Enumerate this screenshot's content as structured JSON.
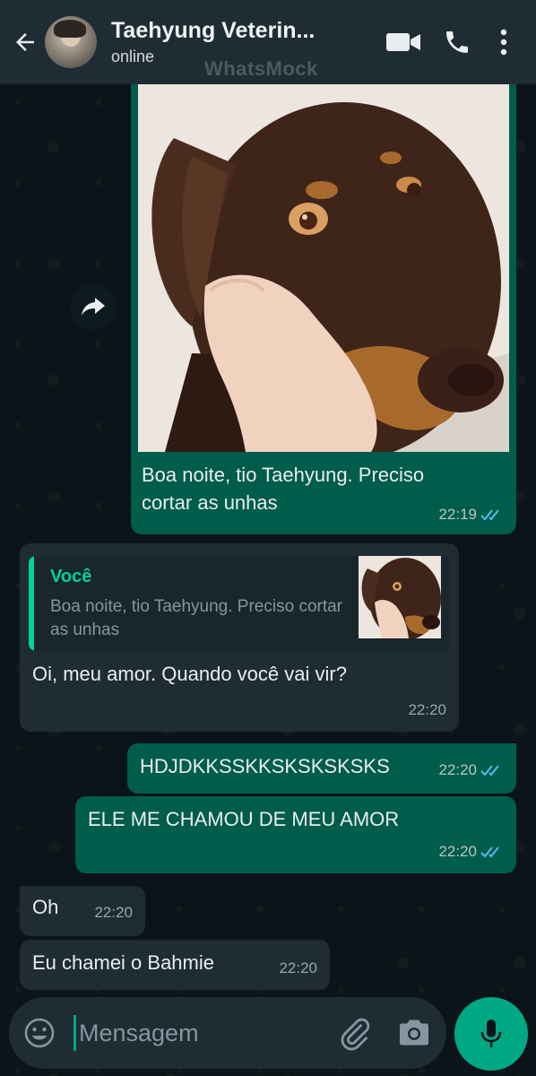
{
  "header": {
    "contact_name": "Taehyung Veterin...",
    "status": "online",
    "watermark": "WhatsMock"
  },
  "icons": {
    "back": "arrow-left-icon",
    "video": "video-camera-icon",
    "call": "phone-icon",
    "menu": "more-vertical-icon",
    "forward": "forward-icon",
    "emoji": "emoji-icon",
    "attach": "paperclip-icon",
    "camera": "camera-icon",
    "mic": "microphone-icon"
  },
  "colors": {
    "outgoing_bubble": "#005c4b",
    "incoming_bubble": "#1f2c33",
    "accent": "#00a884",
    "read_ticks": "#53bdeb"
  },
  "messages": [
    {
      "direction": "out",
      "type": "image",
      "caption": "Boa noite, tio Taehyung. Preciso cortar as unhas",
      "time": "22:19",
      "read": true
    },
    {
      "direction": "in",
      "type": "reply",
      "quoted_author": "Você",
      "quoted_text": "Boa noite, tio Taehyung. Preciso cortar as unhas",
      "text": "Oi, meu amor. Quando você vai vir?",
      "time": "22:20"
    },
    {
      "direction": "out",
      "text": "HDJDKKSSKKSKSKSKSKS",
      "time": "22:20",
      "read": true
    },
    {
      "direction": "out",
      "text": "ELE ME CHAMOU DE MEU AMOR",
      "time": "22:20",
      "read": true
    },
    {
      "direction": "in",
      "text": "Oh",
      "time": "22:20"
    },
    {
      "direction": "in",
      "text": "Eu chamei o Bahmie",
      "time": "22:20"
    }
  ],
  "composer": {
    "placeholder": "Mensagem",
    "value": ""
  }
}
